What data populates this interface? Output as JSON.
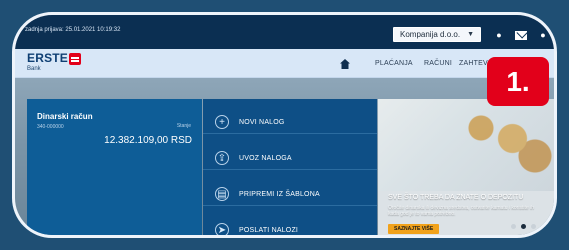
{
  "topbar": {
    "last_login": "zadnja prijava: 25.01.2021 10:19:32",
    "company_value": "Kompanija d.o.o.",
    "icons": [
      "info-icon",
      "mail-icon",
      "user-icon"
    ]
  },
  "navbar": {
    "brand": "ERSTE",
    "brand_sub": "Bank",
    "items": [
      {
        "label": "PLAĆANJA"
      },
      {
        "label": "RAČUNI"
      },
      {
        "label": "ZAHTEVI"
      }
    ]
  },
  "account": {
    "name": "Dinarski račun",
    "number": "340-000000",
    "balance_label": "Stanje",
    "balance": "12.382.109,00 RSD"
  },
  "actions": [
    {
      "label": "NOVI NALOG",
      "icon": "plus-circle-icon"
    },
    {
      "label": "UVOZ NALOGA",
      "icon": "import-icon"
    },
    {
      "label": "PRIPREMI IZ ŠABLONA",
      "icon": "template-icon"
    },
    {
      "label": "POSLATI NALOZI",
      "icon": "send-icon"
    }
  ],
  "promo": {
    "title": "SVE ŠTO TREBA DA ZNATE O DEPOZITU",
    "text": "Oročite dinarska ili devizna sredstva, ostvarite kamatu i koristite ih kada god je to vama potrebno.",
    "button_label": "SAZNAJTE VIŠE"
  },
  "callout": {
    "number": "1."
  },
  "colors": {
    "topbar": "#0b2f52",
    "navbar": "#d8e7f7",
    "account_panel": "#0e5d97",
    "actions_panel": "#0e4f86",
    "badge": "#e2001a",
    "promo_button": "#f1a21b"
  }
}
